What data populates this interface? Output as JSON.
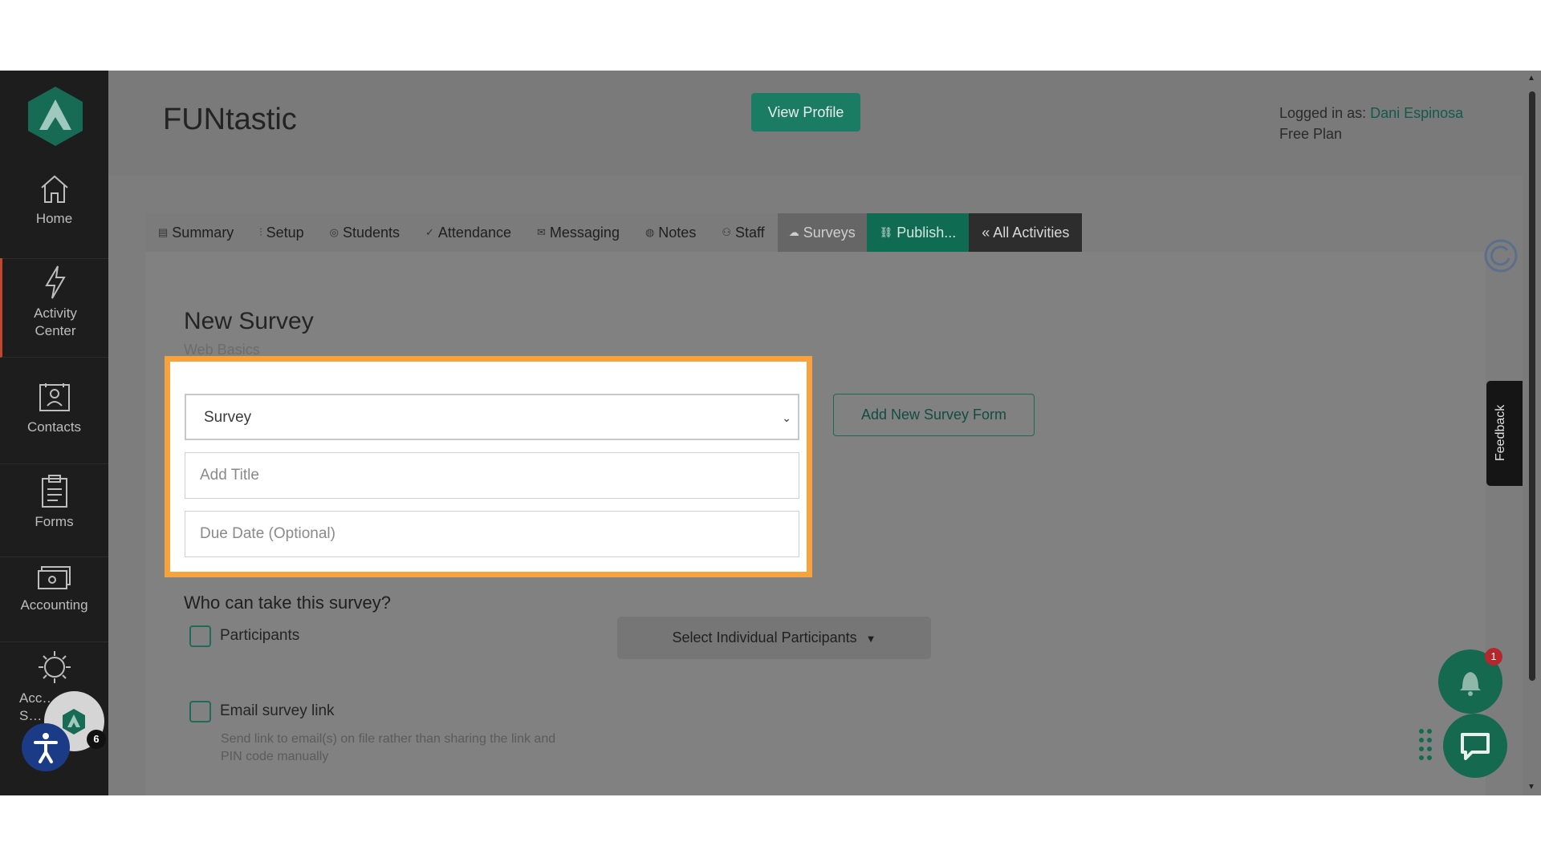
{
  "sidebar": {
    "items": [
      {
        "label": "Home",
        "icon": "home-icon"
      },
      {
        "label": "Activity Center",
        "icon": "lightning-icon"
      },
      {
        "label": "Contacts",
        "icon": "contacts-icon"
      },
      {
        "label": "Forms",
        "icon": "clipboard-icon"
      },
      {
        "label": "Accounting",
        "icon": "money-icon"
      },
      {
        "label": "Acc… S…",
        "icon": "gear-icon"
      }
    ],
    "badge_count": "6"
  },
  "header": {
    "title": "FUNtastic",
    "view_profile": "View Profile",
    "logged_in_label": "Logged in as:",
    "user_name": "Dani Espinosa",
    "plan": "Free Plan"
  },
  "tabs": [
    {
      "label": "Summary",
      "icon": "summary-icon"
    },
    {
      "label": "Setup",
      "icon": "setup-icon"
    },
    {
      "label": "Students",
      "icon": "students-icon"
    },
    {
      "label": "Attendance",
      "icon": "check-icon"
    },
    {
      "label": "Messaging",
      "icon": "mail-icon"
    },
    {
      "label": "Notes",
      "icon": "notes-icon"
    },
    {
      "label": "Staff",
      "icon": "staff-icon"
    },
    {
      "label": "Surveys",
      "icon": "cloud-icon"
    },
    {
      "label": "Publish...",
      "icon": "link-icon"
    },
    {
      "label": "« All Activities",
      "icon": ""
    }
  ],
  "form": {
    "heading": "New Survey",
    "subheading": "Web Basics",
    "survey_select_value": "Survey",
    "title_placeholder": "Add Title",
    "due_date_placeholder": "Due Date (Optional)",
    "add_form_button": "Add New Survey Form",
    "who_label": "Who can take this survey?",
    "participants_label": "Participants",
    "select_participants": "Select Individual Participants",
    "email_label": "Email survey link",
    "email_note": "Send link to email(s) on file rather than sharing the link and PIN code manually"
  },
  "widgets": {
    "feedback_label": "Feedback",
    "notification_count": "1"
  },
  "colors": {
    "highlight": "#f7a23c",
    "brand_green": "#1a7d63"
  }
}
